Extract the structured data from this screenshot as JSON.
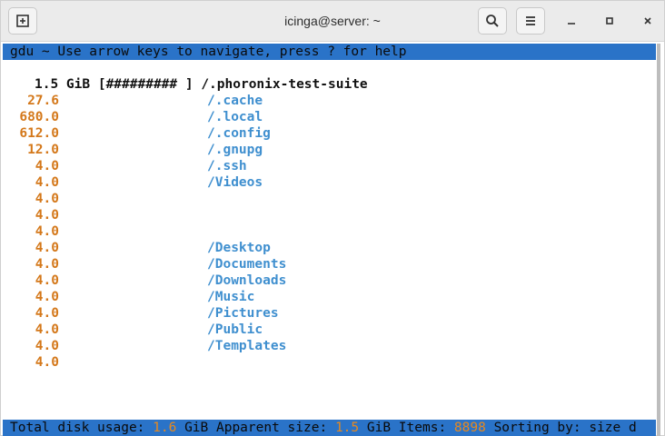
{
  "window": {
    "title": "icinga@server: ~"
  },
  "header_text": "gdu ~ Use arrow keys to navigate, press ? for help",
  "first_row": {
    "text": "1.5 GiB [######### ] /.phoronix-test-suite"
  },
  "rows": [
    {
      "size": "27.6",
      "name": "/.cache"
    },
    {
      "size": "680.0",
      "name": "/.local"
    },
    {
      "size": "612.0",
      "name": "/.config"
    },
    {
      "size": "12.0",
      "name": "/.gnupg"
    },
    {
      "size": "4.0",
      "name": "/.ssh"
    },
    {
      "size": "4.0",
      "name": "/Videos"
    },
    {
      "size": "4.0",
      "name": ""
    },
    {
      "size": "4.0",
      "name": ""
    },
    {
      "size": "4.0",
      "name": ""
    },
    {
      "size": "4.0",
      "name": "/Desktop"
    },
    {
      "size": "4.0",
      "name": "/Documents"
    },
    {
      "size": "4.0",
      "name": "/Downloads"
    },
    {
      "size": "4.0",
      "name": "/Music"
    },
    {
      "size": "4.0",
      "name": "/Pictures"
    },
    {
      "size": "4.0",
      "name": "/Public"
    },
    {
      "size": "4.0",
      "name": "/Templates"
    },
    {
      "size": "4.0",
      "name": ""
    }
  ],
  "footer": {
    "label1": "Total disk usage: ",
    "total": "1.6",
    "label2": " GiB Apparent size: ",
    "apparent": "1.5",
    "label3": " GiB Items: ",
    "items": "8898",
    "label4": " Sorting by: size d"
  },
  "icons": {
    "new_tab": "new-tab-icon",
    "search": "search-icon",
    "menu": "hamburger-menu-icon",
    "minimize": "minimize-icon",
    "maximize": "maximize-icon",
    "close": "close-icon"
  },
  "colors": {
    "header_bar": "#2a73c8",
    "size_text": "#d4781a",
    "dir_text": "#3f8fcf"
  }
}
